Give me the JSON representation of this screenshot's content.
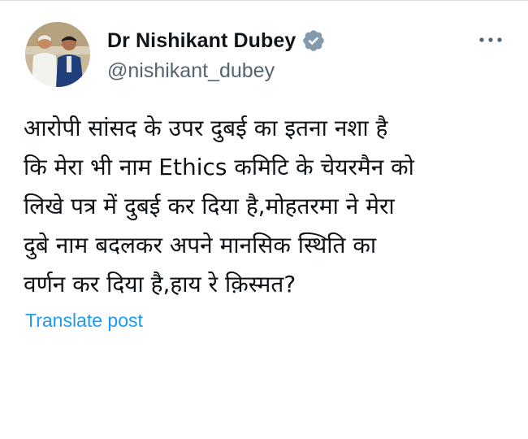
{
  "tweet": {
    "author": {
      "display_name": "Dr Nishikant Dubey",
      "handle": "@nishikant_dubey",
      "verified": true,
      "verified_badge_color": "#829aab"
    },
    "more_icon": "more-horizontal-icon",
    "text_lines": [
      "आरोपी सांसद के उपर दुबई का इतना नशा है",
      "कि मेरा भी नाम Ethics कमिटि के चेयरमैन को",
      "लिखे पत्र में दुबई कर दिया है,मोहतरमा ने मेरा",
      "दुबे नाम बदलकर अपने मानसिक स्थिति का",
      "वर्णन कर दिया है,हाय रे क़िस्मत?"
    ],
    "translate_label": "Translate post"
  },
  "colors": {
    "text_primary": "#0f1419",
    "text_secondary": "#536471",
    "link": "#1d9bf0"
  }
}
